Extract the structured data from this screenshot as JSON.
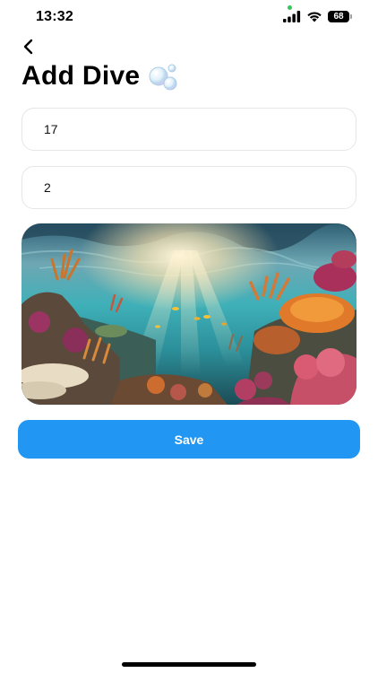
{
  "status_bar": {
    "time": "13:32",
    "battery": "68",
    "icons": [
      "signal-icon",
      "wifi-icon",
      "battery-icon"
    ]
  },
  "header": {
    "back_icon": "chevron-left-icon",
    "title": "Add Dive",
    "title_icon": "bubbles-icon"
  },
  "form": {
    "field_1": {
      "value": "17"
    },
    "field_2": {
      "value": "2"
    },
    "photo": {
      "subject": "underwater coral reef photo"
    }
  },
  "actions": {
    "save_label": "Save"
  },
  "colors": {
    "accent": "#2196f3",
    "field_border": "#e6e6ea",
    "status_dot": "#34c759"
  }
}
